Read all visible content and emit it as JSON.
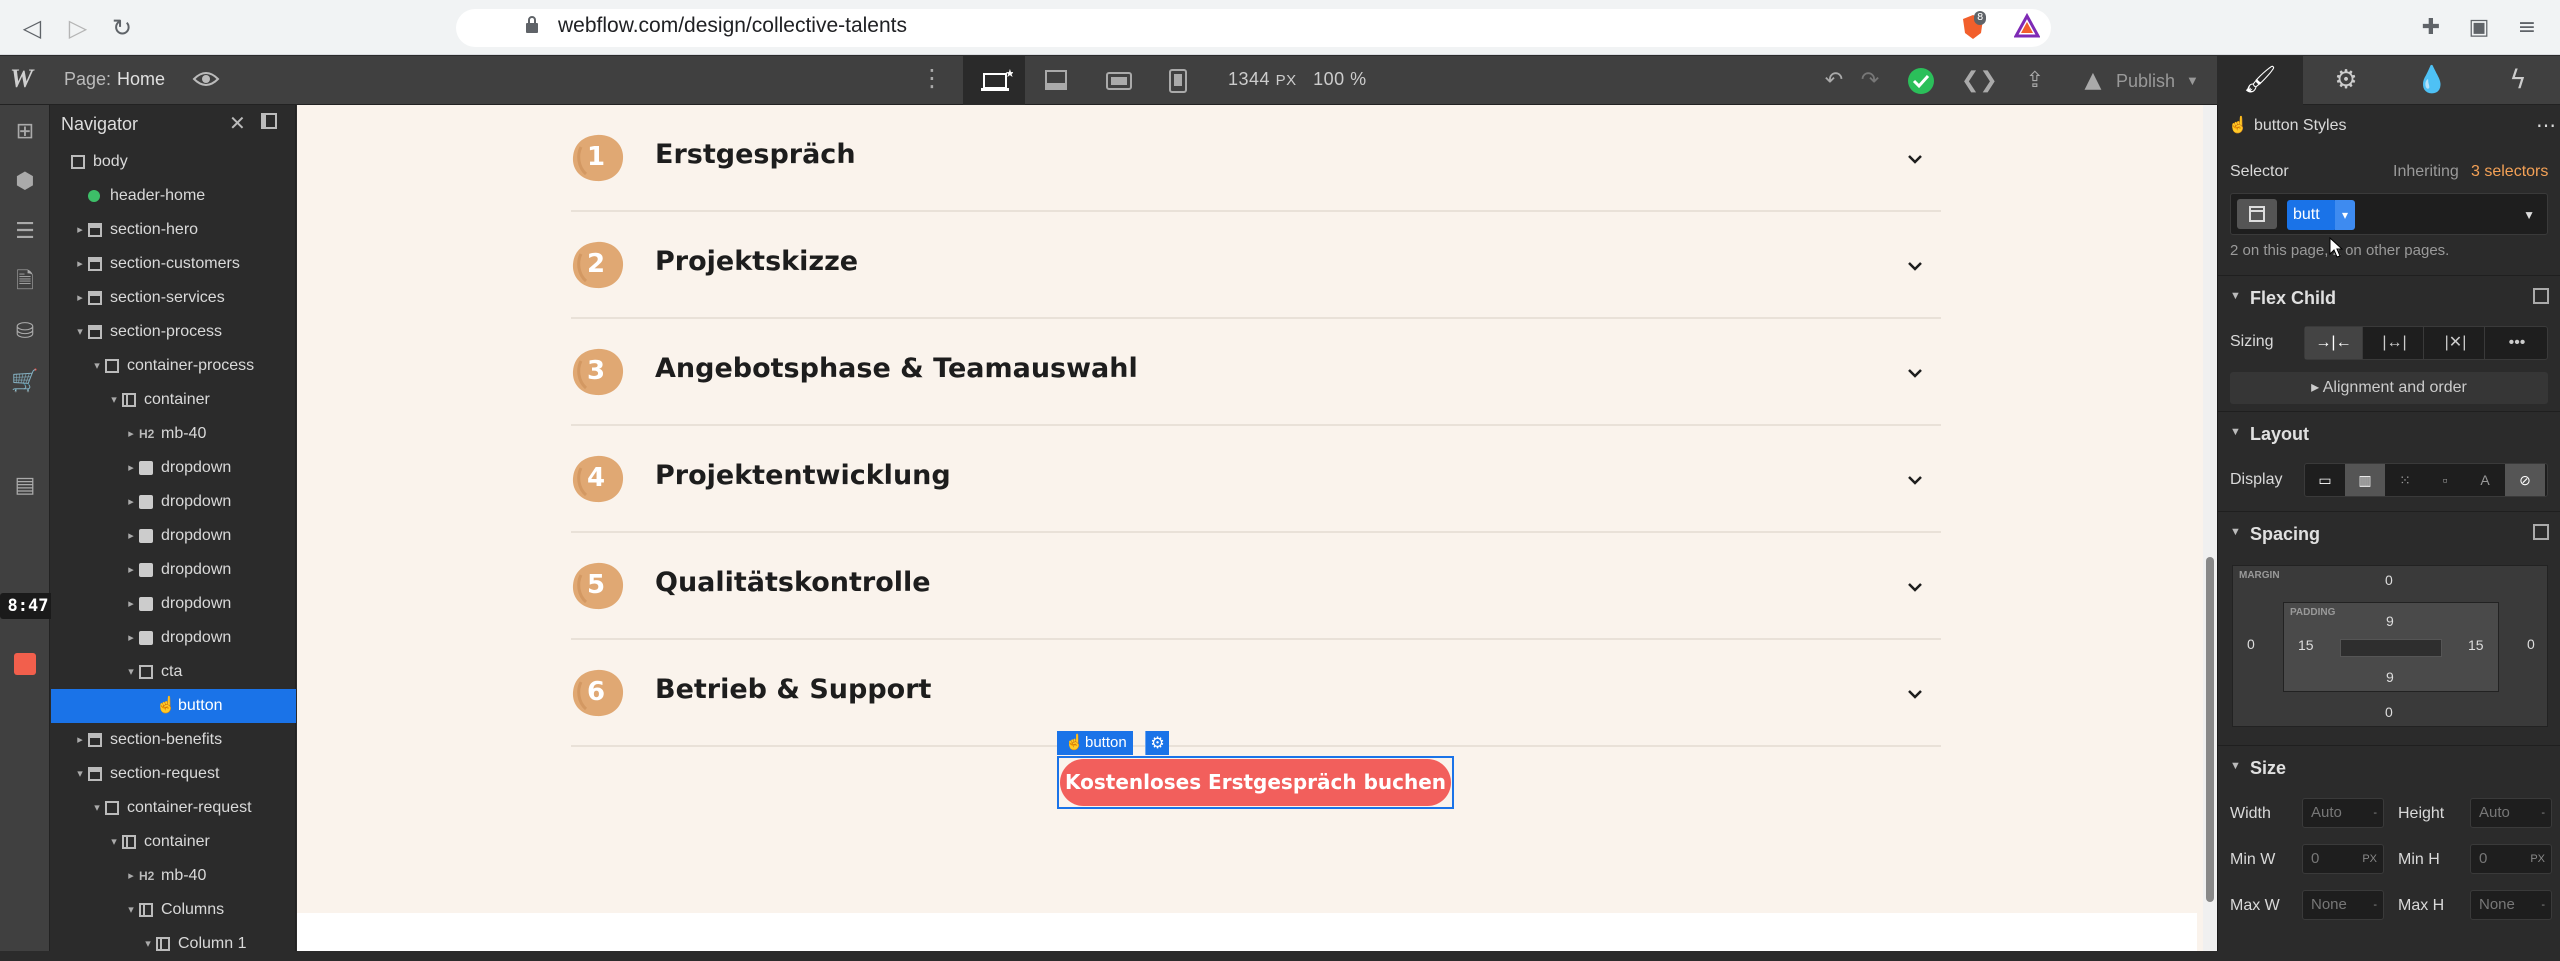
{
  "browser": {
    "url": "webflow.com/design/collective-talents",
    "brave_badge": "8"
  },
  "topbar": {
    "page_label": "Page:",
    "page_value": "Home",
    "width_value": "1344",
    "width_unit": "PX",
    "zoom": "100 %",
    "publish_label": "Publish"
  },
  "rail": {
    "time": "8:47"
  },
  "navigator": {
    "title": "Navigator",
    "items": [
      {
        "label": "body",
        "depth": 0,
        "icon": "box",
        "caret": ""
      },
      {
        "label": "header-home",
        "depth": 1,
        "icon": "comp",
        "caret": ""
      },
      {
        "label": "section-hero",
        "depth": 1,
        "icon": "section",
        "caret": "▸"
      },
      {
        "label": "section-customers",
        "depth": 1,
        "icon": "section",
        "caret": "▸"
      },
      {
        "label": "section-services",
        "depth": 1,
        "icon": "section",
        "caret": "▸"
      },
      {
        "label": "section-process",
        "depth": 1,
        "icon": "section",
        "caret": "▾"
      },
      {
        "label": "container-process",
        "depth": 2,
        "icon": "box",
        "caret": "▾"
      },
      {
        "label": "container",
        "depth": 3,
        "icon": "cont",
        "caret": "▾"
      },
      {
        "label": "mb-40",
        "depth": 4,
        "icon": "h2",
        "caret": "▸"
      },
      {
        "label": "dropdown",
        "depth": 4,
        "icon": "dd",
        "caret": "▸"
      },
      {
        "label": "dropdown",
        "depth": 4,
        "icon": "dd",
        "caret": "▸"
      },
      {
        "label": "dropdown",
        "depth": 4,
        "icon": "dd",
        "caret": "▸"
      },
      {
        "label": "dropdown",
        "depth": 4,
        "icon": "dd",
        "caret": "▸"
      },
      {
        "label": "dropdown",
        "depth": 4,
        "icon": "dd",
        "caret": "▸"
      },
      {
        "label": "dropdown",
        "depth": 4,
        "icon": "dd",
        "caret": "▸"
      },
      {
        "label": "cta",
        "depth": 4,
        "icon": "box",
        "caret": "▾"
      },
      {
        "label": "button",
        "depth": 5,
        "icon": "hand",
        "caret": "",
        "selected": true
      },
      {
        "label": "section-benefits",
        "depth": 1,
        "icon": "section",
        "caret": "▸"
      },
      {
        "label": "section-request",
        "depth": 1,
        "icon": "section",
        "caret": "▾"
      },
      {
        "label": "container-request",
        "depth": 2,
        "icon": "box",
        "caret": "▾"
      },
      {
        "label": "container",
        "depth": 3,
        "icon": "cont",
        "caret": "▾"
      },
      {
        "label": "mb-40",
        "depth": 4,
        "icon": "h2",
        "caret": "▸"
      },
      {
        "label": "Columns",
        "depth": 4,
        "icon": "cont",
        "caret": "▾"
      },
      {
        "label": "Column 1",
        "depth": 5,
        "icon": "cont",
        "caret": "▾"
      }
    ]
  },
  "canvas": {
    "steps": [
      {
        "num": "1",
        "title": "Erstgespräch"
      },
      {
        "num": "2",
        "title": "Projektskizze"
      },
      {
        "num": "3",
        "title": "Angebotsphase & Teamauswahl"
      },
      {
        "num": "4",
        "title": "Projektentwicklung"
      },
      {
        "num": "5",
        "title": "Qualitätskontrolle"
      },
      {
        "num": "6",
        "title": "Betrieb & Support"
      }
    ],
    "selected_tag": "button",
    "cta_label": "Kostenloses Erstgespräch buchen",
    "accent_color": "#f25f5c",
    "badge_color": "#e0a873"
  },
  "style_panel": {
    "header": "button Styles",
    "selector_label": "Selector",
    "inheriting_prefix": "Inheriting",
    "inheriting_count": "3 selectors",
    "selector_chip": "butt",
    "usage_note": "2 on this page, 2 on other pages.",
    "flex_child_title": "Flex Child",
    "sizing_label": "Sizing",
    "alignment_label": "Alignment and order",
    "layout_title": "Layout",
    "display_label": "Display",
    "spacing_title": "Spacing",
    "margin_label": "MARGIN",
    "padding_label": "PADDING",
    "margin": {
      "top": "0",
      "right": "0",
      "bottom": "0",
      "left": "0"
    },
    "padding": {
      "top": "9",
      "right": "15",
      "bottom": "9",
      "left": "15"
    },
    "size_title": "Size",
    "width_label": "Width",
    "height_label": "Height",
    "width_value": "Auto",
    "height_value": "Auto",
    "min_w_label": "Min W",
    "min_h_label": "Min H",
    "min_w_value": "0",
    "min_h_value": "0",
    "min_unit": "PX",
    "max_w_label": "Max W",
    "max_h_label": "Max H",
    "max_w_value": "None",
    "max_h_value": "None"
  }
}
